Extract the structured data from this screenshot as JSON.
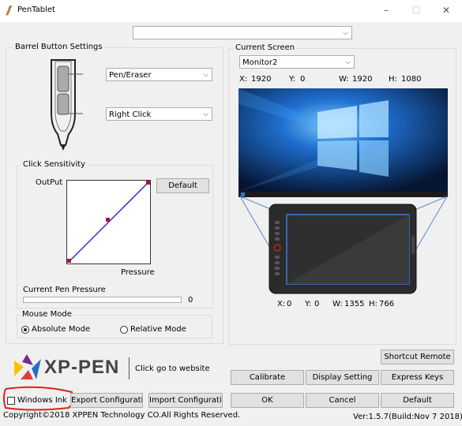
{
  "window": {
    "title": "PenTablet",
    "minimize_glyph": "–",
    "maximize_glyph": "☐",
    "close_glyph": "✕"
  },
  "top_combo": {
    "value": ""
  },
  "barrel": {
    "title": "Barrel Button Settings",
    "upper_value": "Pen/Eraser",
    "lower_value": "Right Click"
  },
  "sensitivity": {
    "title": "Click Sensitivity",
    "output_label": "OutPut",
    "default_label": "Default",
    "pressure_label": "Pressure",
    "current_pressure_label": "Current Pen Pressure",
    "pressure_value": "0",
    "pressure_fraction": 0
  },
  "mouse_mode": {
    "title": "Mouse Mode",
    "absolute_label": "Absolute Mode",
    "relative_label": "Relative Mode",
    "selected": "absolute"
  },
  "screen": {
    "title": "Current Screen",
    "monitor_value": "Monitor2",
    "x_label": "X:",
    "x_value": "1920",
    "y_label": "Y:",
    "y_value": "0",
    "w_label": "W:",
    "w_value": "1920",
    "h_label": "H:",
    "h_value": "1080"
  },
  "tablet_area": {
    "x_label": "X:",
    "x_value": "0",
    "y_label": "Y:",
    "y_value": "0",
    "w_label": "W:",
    "w_value": "1355",
    "h_label": "H:",
    "h_value": "766"
  },
  "buttons": {
    "shortcut_remote": "Shortcut Remote",
    "calibrate": "Calibrate",
    "display_setting": "Display Setting",
    "express_keys": "Express Keys",
    "export_config": "Export Configuration",
    "import_config": "Import Configuration",
    "ok": "OK",
    "cancel": "Cancel",
    "default": "Default"
  },
  "brand": {
    "logo_text": "XP-PEN",
    "website_link": "Click go to website"
  },
  "windows_ink": {
    "label": "Windows Ink",
    "checked": false
  },
  "footer": {
    "copyright": "Copyright©2018  XPPEN Technology CO.All Rights Reserved.",
    "version": "Ver:1.5.7(Build:Nov  7 2018)"
  },
  "colors": {
    "accent_circle": "#e02020",
    "curve_line": "#2b2bd6",
    "curve_point": "#b0103a",
    "logo_yellow": "#f5c400",
    "logo_purple": "#7b2a8f",
    "logo_blue": "#2b6cc4",
    "logo_red": "#e23b3b"
  }
}
